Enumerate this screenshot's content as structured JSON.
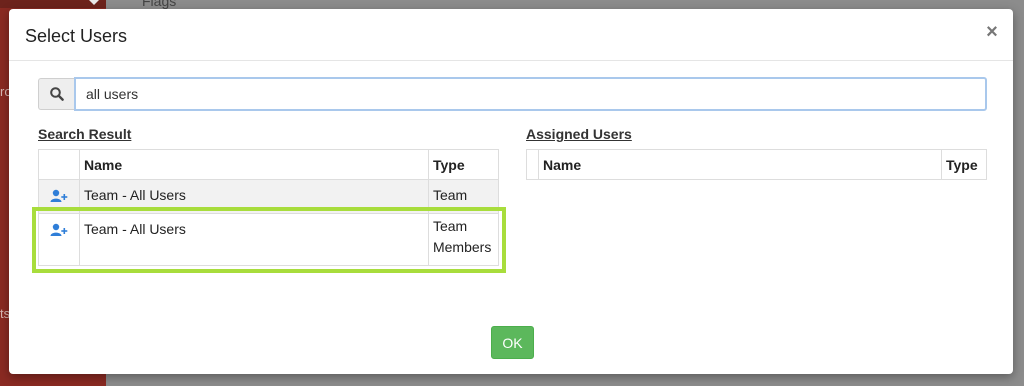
{
  "background": {
    "flags_label": "Flags",
    "side_text_1": "ro",
    "side_text_2": "ts"
  },
  "modal": {
    "title": "Select Users",
    "close_label": "×"
  },
  "search": {
    "value": "all users",
    "placeholder": ""
  },
  "search_result": {
    "title": "Search Result",
    "headers": {
      "name": "Name",
      "type": "Type"
    },
    "rows": [
      {
        "name": "Team - All Users",
        "type": "Team"
      },
      {
        "name": "Team - All Users",
        "type": "Team Members",
        "highlighted": true
      }
    ]
  },
  "assigned_users": {
    "title": "Assigned Users",
    "headers": {
      "name": "Name",
      "type": "Type"
    }
  },
  "footer": {
    "ok_label": "OK"
  },
  "colors": {
    "ok_button": "#5cb85c",
    "highlight": "#a8dd3c",
    "add_user_icon": "#2f7ed8",
    "sidebar": "#8a2a22"
  },
  "icons": {
    "search": "search-icon",
    "add_user": "add-user-icon",
    "close": "close-icon"
  }
}
